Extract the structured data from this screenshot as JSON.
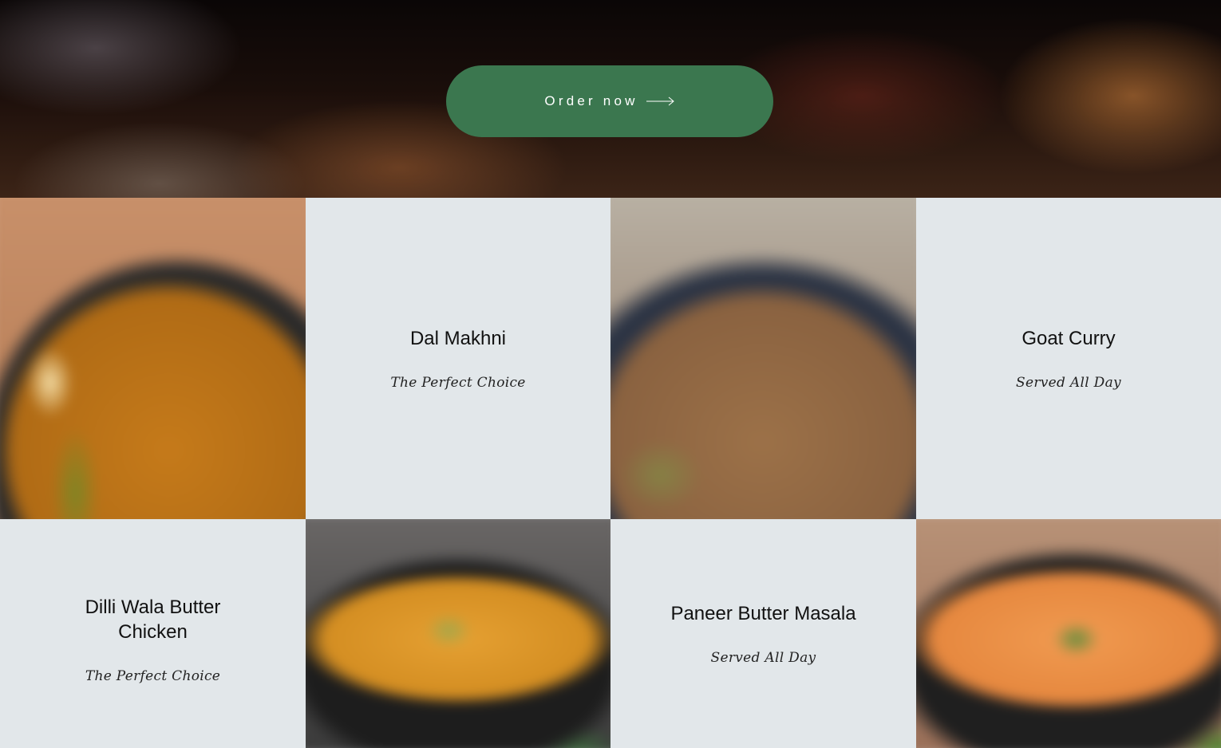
{
  "hero": {
    "order_button_label": "Order now",
    "button_color": "#3d7650",
    "arrow_icon": "arrow-right-icon"
  },
  "menu": {
    "items": [
      {
        "name": "Dal Makhni",
        "subtitle": "The Perfect Choice"
      },
      {
        "name": "Goat Curry",
        "subtitle": "Served All Day"
      },
      {
        "name": "Dilli Wala Butter Chicken",
        "name_line1": "Dilli Wala Butter",
        "name_line2": "Chicken",
        "subtitle": "The Perfect Choice"
      },
      {
        "name": "Paneer Butter Masala",
        "subtitle": "Served All Day"
      }
    ],
    "tile_background": "#e2e7ea"
  }
}
